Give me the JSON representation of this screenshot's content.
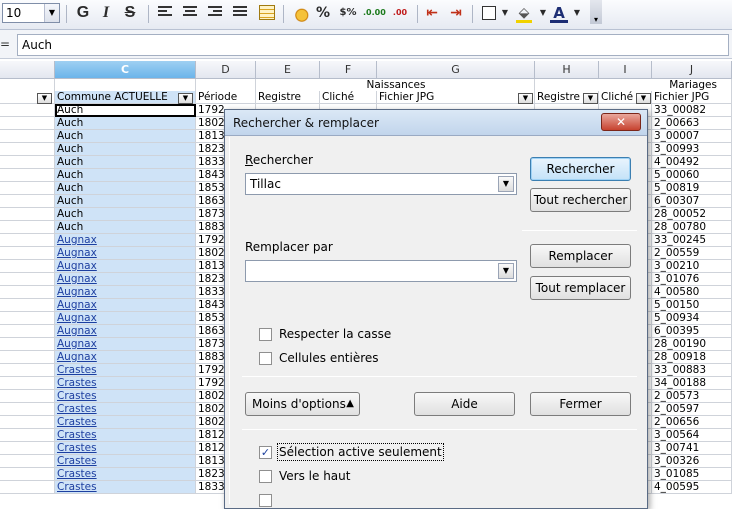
{
  "toolbar": {
    "font_size": "10",
    "bold": "G",
    "italic": "I",
    "strike": "S",
    "percent": "%",
    "currency": "$%",
    "add_decimal": ".0.00",
    "del_decimal": ".00"
  },
  "formula_bar": {
    "eq": "=",
    "value": "Auch"
  },
  "columns": {
    "C": "C",
    "D": "D",
    "E": "E",
    "F": "F",
    "G": "G",
    "H": "H",
    "I": "I",
    "J": "J"
  },
  "group_headers": {
    "naissances": "Naissances",
    "mariages": "Mariages"
  },
  "field_headers": {
    "commune": "Commune ACTUELLE",
    "periode": "Période",
    "registre1": "Registre",
    "cliche1": "Cliché",
    "fichier1": "Fichier JPG",
    "registre2": "Registre",
    "cliche2": "Cliché",
    "fichier2": "Fichier JPG"
  },
  "rows": [
    {
      "commune": "Auch",
      "periode": "1792",
      "fichier": "33_00082"
    },
    {
      "commune": "Auch",
      "periode": "1802",
      "fichier": "2_00663"
    },
    {
      "commune": "Auch",
      "periode": "1813",
      "fichier": "3_00007"
    },
    {
      "commune": "Auch",
      "periode": "1823",
      "fichier": "3_00993"
    },
    {
      "commune": "Auch",
      "periode": "1833",
      "fichier": "4_00492"
    },
    {
      "commune": "Auch",
      "periode": "1843",
      "fichier": "5_00060"
    },
    {
      "commune": "Auch",
      "periode": "1853",
      "fichier": "5_00819"
    },
    {
      "commune": "Auch",
      "periode": "1863",
      "fichier": "6_00307"
    },
    {
      "commune": "Auch",
      "periode": "1873",
      "fichier": "28_00052"
    },
    {
      "commune": "Auch",
      "periode": "1883",
      "fichier": "28_00780"
    },
    {
      "commune": "Augnax",
      "periode": "1792",
      "fichier": "33_00245"
    },
    {
      "commune": "Augnax",
      "periode": "1802",
      "fichier": "2_00559"
    },
    {
      "commune": "Augnax",
      "periode": "1813",
      "fichier": "3_00210"
    },
    {
      "commune": "Augnax",
      "periode": "1823",
      "fichier": "3_01076"
    },
    {
      "commune": "Augnax",
      "periode": "1833",
      "fichier": "4_00580"
    },
    {
      "commune": "Augnax",
      "periode": "1843",
      "fichier": "5_00150"
    },
    {
      "commune": "Augnax",
      "periode": "1853",
      "fichier": "5_00934"
    },
    {
      "commune": "Augnax",
      "periode": "1863",
      "fichier": "6_00395"
    },
    {
      "commune": "Augnax",
      "periode": "1873",
      "fichier": "28_00190"
    },
    {
      "commune": "Augnax",
      "periode": "1883",
      "fichier": "28_00918"
    },
    {
      "commune": "Crastes",
      "periode": "1792",
      "fichier": "33_00883"
    },
    {
      "commune": "Crastes",
      "periode": "1792",
      "fichier": "34_00188"
    },
    {
      "commune": "Crastes",
      "periode": "1802",
      "fichier": "2_00573"
    },
    {
      "commune": "Crastes",
      "periode": "1802",
      "fichier": "2_00597"
    },
    {
      "commune": "Crastes",
      "periode": "1802",
      "fichier": "2_00656"
    },
    {
      "commune": "Crastes",
      "periode": "1812",
      "fichier": "3_00564"
    },
    {
      "commune": "Crastes",
      "periode": "1812",
      "fichier": "3_00741"
    },
    {
      "commune": "Crastes",
      "periode": "1813",
      "fichier": "3_00326"
    },
    {
      "commune": "Crastes",
      "periode": "1823",
      "fichier": "3_01085"
    },
    {
      "commune": "Crastes",
      "periode": "1833",
      "fichier": "4_00595"
    }
  ],
  "dialog": {
    "title": "Rechercher & remplacer",
    "close": "✕",
    "search_label": "Rechercher",
    "search_value": "Tillac",
    "replace_label": "Remplacer par",
    "replace_value": "",
    "btn_search": "Rechercher",
    "btn_search_all": "Tout rechercher",
    "btn_replace": "Remplacer",
    "btn_replace_all": "Tout remplacer",
    "match_case": "Respecter la casse",
    "whole_cells": "Cellules entières",
    "btn_less_options": "Moins d'options",
    "btn_help": "Aide",
    "btn_close": "Fermer",
    "current_selection": "Sélection active seulement",
    "backwards": "Vers le haut",
    "match_case_checked": false,
    "whole_cells_checked": false,
    "current_selection_checked": true,
    "backwards_checked": false
  }
}
